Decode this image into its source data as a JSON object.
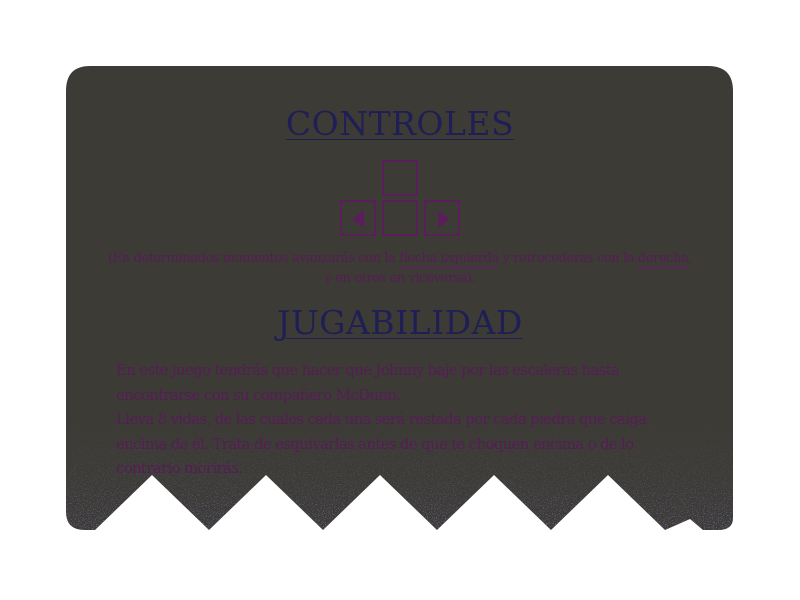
{
  "controls": {
    "title": "CONTROLES",
    "keys": {
      "up": "",
      "left": "arrow-left-icon",
      "down": "",
      "right": "arrow-right-icon"
    },
    "note": {
      "part1": "(En determinados momentos avanzarás con la ",
      "flecha_izquierda": "flecha izquierda",
      "part2": " y retrocederas con la ",
      "derecha": "derecha",
      "part3": ",",
      "line2": "y en otros en viceversa)."
    }
  },
  "gameplay": {
    "title": "JUGABILIDAD",
    "paragraph1": "En este juego tendrás que hacer que Johnny baje por las escaleras hasta encontrarse con su compañero McDunn.",
    "paragraph2": "Lleva 8 vidas, de las cuales cada una será restada por cada piedra que caiga encima de él. Trata de esquivarlas antes de que te choquen encima o de lo contrario morirás."
  },
  "colors": {
    "card_background": "#3d3b36",
    "heading": "#1f1f55",
    "text": "#571c57",
    "key_border": "#5a1f5a",
    "speckle": "#2a2a5a",
    "page_background": "#ffffff"
  }
}
